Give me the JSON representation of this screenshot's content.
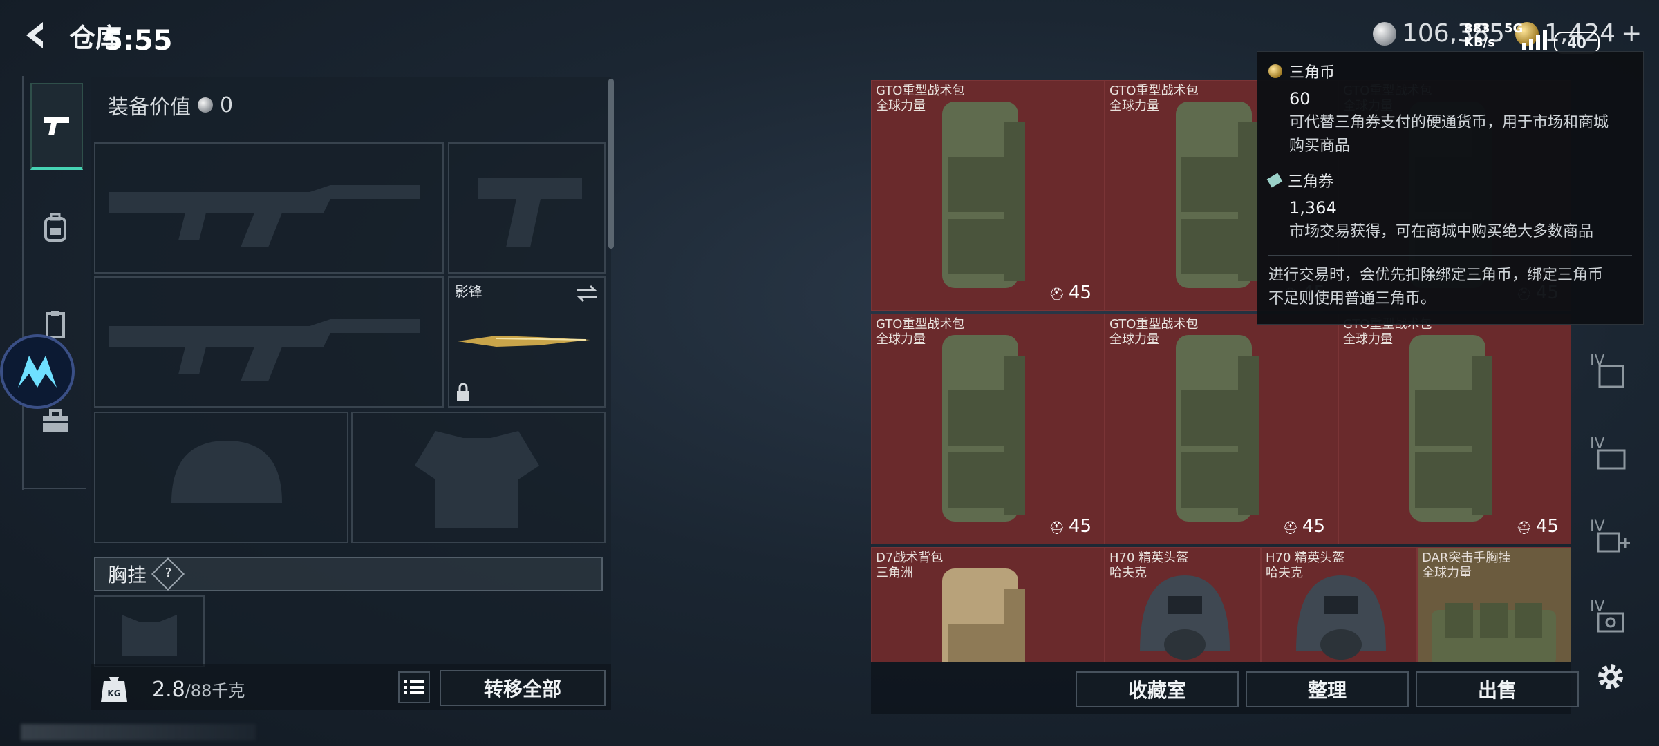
{
  "header": {
    "title": "仓库",
    "clock": "5:55",
    "silver_amount": "106,385",
    "gold_amount": "1,424",
    "add_label": "+",
    "network_speed": "883\nKB/s",
    "network_type": "5G",
    "battery": "40"
  },
  "loadout": {
    "value_label": "装备价值",
    "value": "0",
    "melee_name": "影锋",
    "chest_label": "胸挂",
    "help": "?",
    "weight": "2.8",
    "weight_cap": "/88千克",
    "kb_label": "KG",
    "transfer_all": "转移全部"
  },
  "storage": {
    "items": [
      {
        "name": "GTO重型战术包",
        "brand": "全球力量",
        "durability": "45",
        "color": "red"
      },
      {
        "name": "GTO重型战术包",
        "brand": "全球力量",
        "durability": "45",
        "color": "red"
      },
      {
        "name": "GTO重型战术包",
        "brand": "全球力量",
        "durability": "45",
        "color": "red"
      },
      {
        "name": "GTO重型战术包",
        "brand": "全球力量",
        "durability": "45",
        "color": "red"
      },
      {
        "name": "GTO重型战术包",
        "brand": "全球力量",
        "durability": "45",
        "color": "red"
      },
      {
        "name": "GTO重型战术包",
        "brand": "全球力量",
        "durability": "45",
        "color": "red"
      },
      {
        "name": "D7战术背包",
        "brand": "三角洲",
        "durability": "",
        "color": "red"
      },
      {
        "name": "H70 精英头盔",
        "brand": "哈夫克",
        "durability": "",
        "color": "red"
      },
      {
        "name": "H70 精英头盔",
        "brand": "哈夫克",
        "durability": "",
        "color": "red"
      },
      {
        "name": "DAR突击手胸挂",
        "brand": "全球力量",
        "durability": "",
        "color": "tan"
      }
    ],
    "collection_room": "收藏室",
    "sort": "整理",
    "sell": "出售"
  },
  "tooltip": {
    "coin_name": "三角币",
    "coin_amount": "60",
    "coin_desc_1": "可代替三角券支付的硬通货币，用于市场和商城",
    "coin_desc_2": "购买商品",
    "ticket_name": "三角券",
    "ticket_amount": "1,364",
    "ticket_desc": "市场交易获得，可在商城中购买绝大多数商品",
    "footer_1": "进行交易时，会优先扣除绑定三角币，绑定三角币",
    "footer_2": "不足则使用普通三角币。"
  },
  "right_rail": {
    "labels": [
      "IV",
      "IV",
      "IV",
      "IV"
    ]
  },
  "colors": {
    "accent": "#46d3b4",
    "cell_red": "#6a2a2c",
    "cell_tan": "#6b5b3e",
    "panel_bg": "#161f28"
  }
}
